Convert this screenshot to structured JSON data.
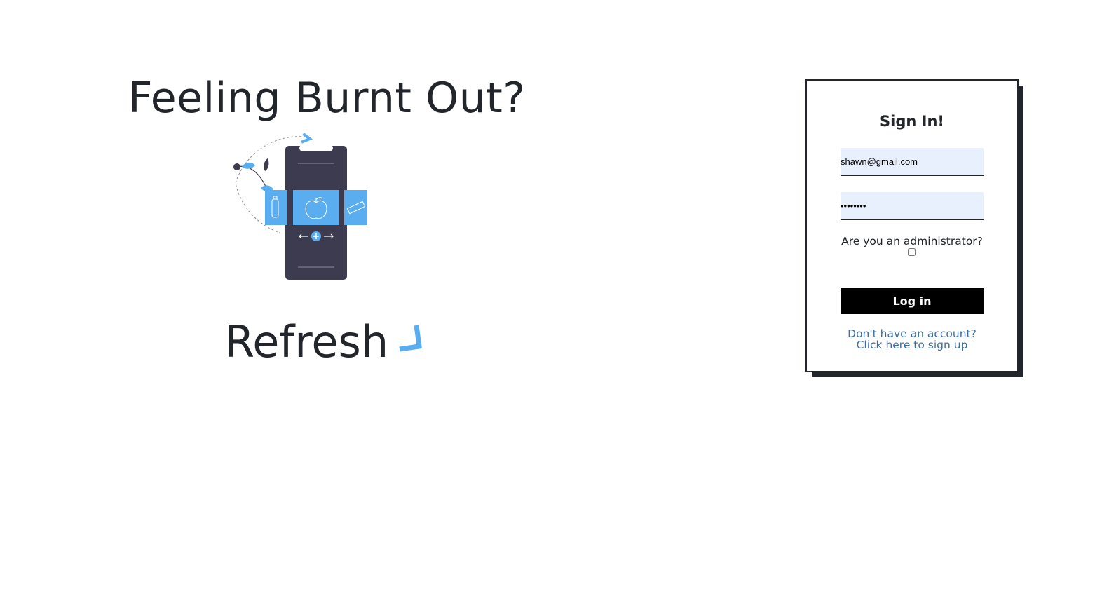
{
  "hero": {
    "title": "Feeling Burnt Out?"
  },
  "illustration": {
    "icon": "phone-with-food-options-illustration",
    "colors": {
      "phone": "#3d3b50",
      "accent": "#5aadee",
      "leaf_dark": "#3d3b50"
    }
  },
  "brand": {
    "name": "Refresh",
    "mark_icon": "brand-checkmark-icon",
    "mark_color": "#5aadee"
  },
  "signin": {
    "title": "Sign In!",
    "email_value": "shawn@gmail.com",
    "password_value": "shawnpwd",
    "admin_label": "Are you an administrator?",
    "admin_checked": false,
    "login_label": "Log in",
    "signup_line1": "Don't have an account?",
    "signup_line2": "Click here to sign up"
  },
  "colors": {
    "text": "#22252a",
    "input_bg": "#e8f0fe",
    "link": "#3d6d9e",
    "button_bg": "#000000",
    "card_shadow": "#22252a"
  }
}
